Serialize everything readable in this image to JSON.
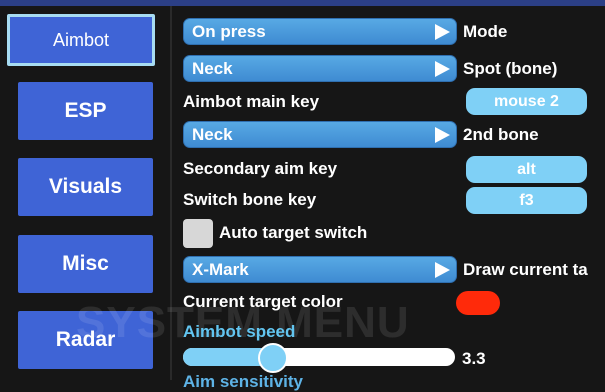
{
  "watermark": "SYSTEM MENU",
  "sidebar": {
    "items": [
      {
        "label": "Aimbot"
      },
      {
        "label": "ESP"
      },
      {
        "label": "Visuals"
      },
      {
        "label": "Misc"
      },
      {
        "label": "Radar"
      }
    ],
    "active": "Aimbot"
  },
  "settings": {
    "mode": {
      "value": "On press",
      "label": "Mode"
    },
    "spot": {
      "value": "Neck",
      "label": "Spot (bone)"
    },
    "main_key": {
      "label": "Aimbot main key",
      "value": "mouse 2"
    },
    "second_bone": {
      "value": "Neck",
      "label": "2nd bone"
    },
    "secondary_key": {
      "label": "Secondary aim key",
      "value": "alt"
    },
    "switch_bone_key": {
      "label": "Switch bone key",
      "value": "f3"
    },
    "auto_target": {
      "label": "Auto target switch",
      "checked": false
    },
    "draw_target": {
      "value": "X-Mark",
      "label": "Draw current ta"
    },
    "target_color": {
      "label": "Current target color",
      "color": "#ff2a0a"
    },
    "aimbot_speed": {
      "label": "Aimbot speed",
      "value": "3.3",
      "fraction": 0.33
    },
    "next_section_label": "Aim sensitivity"
  },
  "colors": {
    "accent": "#3f64d6",
    "combo": "#4f9de0",
    "key_button": "#7fd0f6",
    "section_title": "#62c5f0",
    "background": "#161616"
  }
}
